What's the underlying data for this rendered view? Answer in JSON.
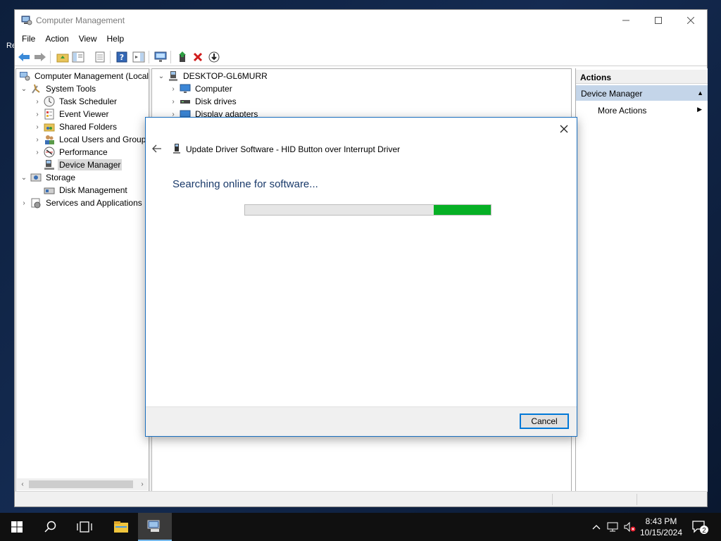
{
  "desktop": {
    "partial_label": "Re"
  },
  "window": {
    "title": "Computer Management",
    "controls": {
      "minimize": "—",
      "maximize": "☐",
      "close": "✕"
    }
  },
  "menu": [
    "File",
    "Action",
    "View",
    "Help"
  ],
  "toolbar_icons": [
    "back-icon",
    "forward-icon",
    "up-folder-icon",
    "show-hide-tree-icon",
    "properties-icon",
    "help-icon",
    "show-hide-action-pane-icon",
    "computer-monitor-icon",
    "update-driver-icon",
    "uninstall-icon",
    "scan-hardware-icon"
  ],
  "tree": {
    "root": "Computer Management (Local",
    "system_tools": "System Tools",
    "task_scheduler": "Task Scheduler",
    "event_viewer": "Event Viewer",
    "shared_folders": "Shared Folders",
    "local_users": "Local Users and Groups",
    "performance": "Performance",
    "device_manager": "Device Manager",
    "storage": "Storage",
    "disk_management": "Disk Management",
    "services": "Services and Applications"
  },
  "devices": {
    "computer_name": "DESKTOP-GL6MURR",
    "items": [
      "Computer",
      "Disk drives",
      "Display adapters"
    ]
  },
  "actions": {
    "header": "Actions",
    "section": "Device Manager",
    "more": "More Actions"
  },
  "dialog": {
    "title": "Update Driver Software - HID Button over Interrupt Driver",
    "heading": "Searching online for software...",
    "cancel_label": "Cancel",
    "progress": {
      "style": "indeterminate-marquee",
      "segment_color": "#06b025"
    }
  },
  "taskbar": {
    "time": "8:43 PM",
    "date": "10/15/2024",
    "notification_count": "2"
  }
}
